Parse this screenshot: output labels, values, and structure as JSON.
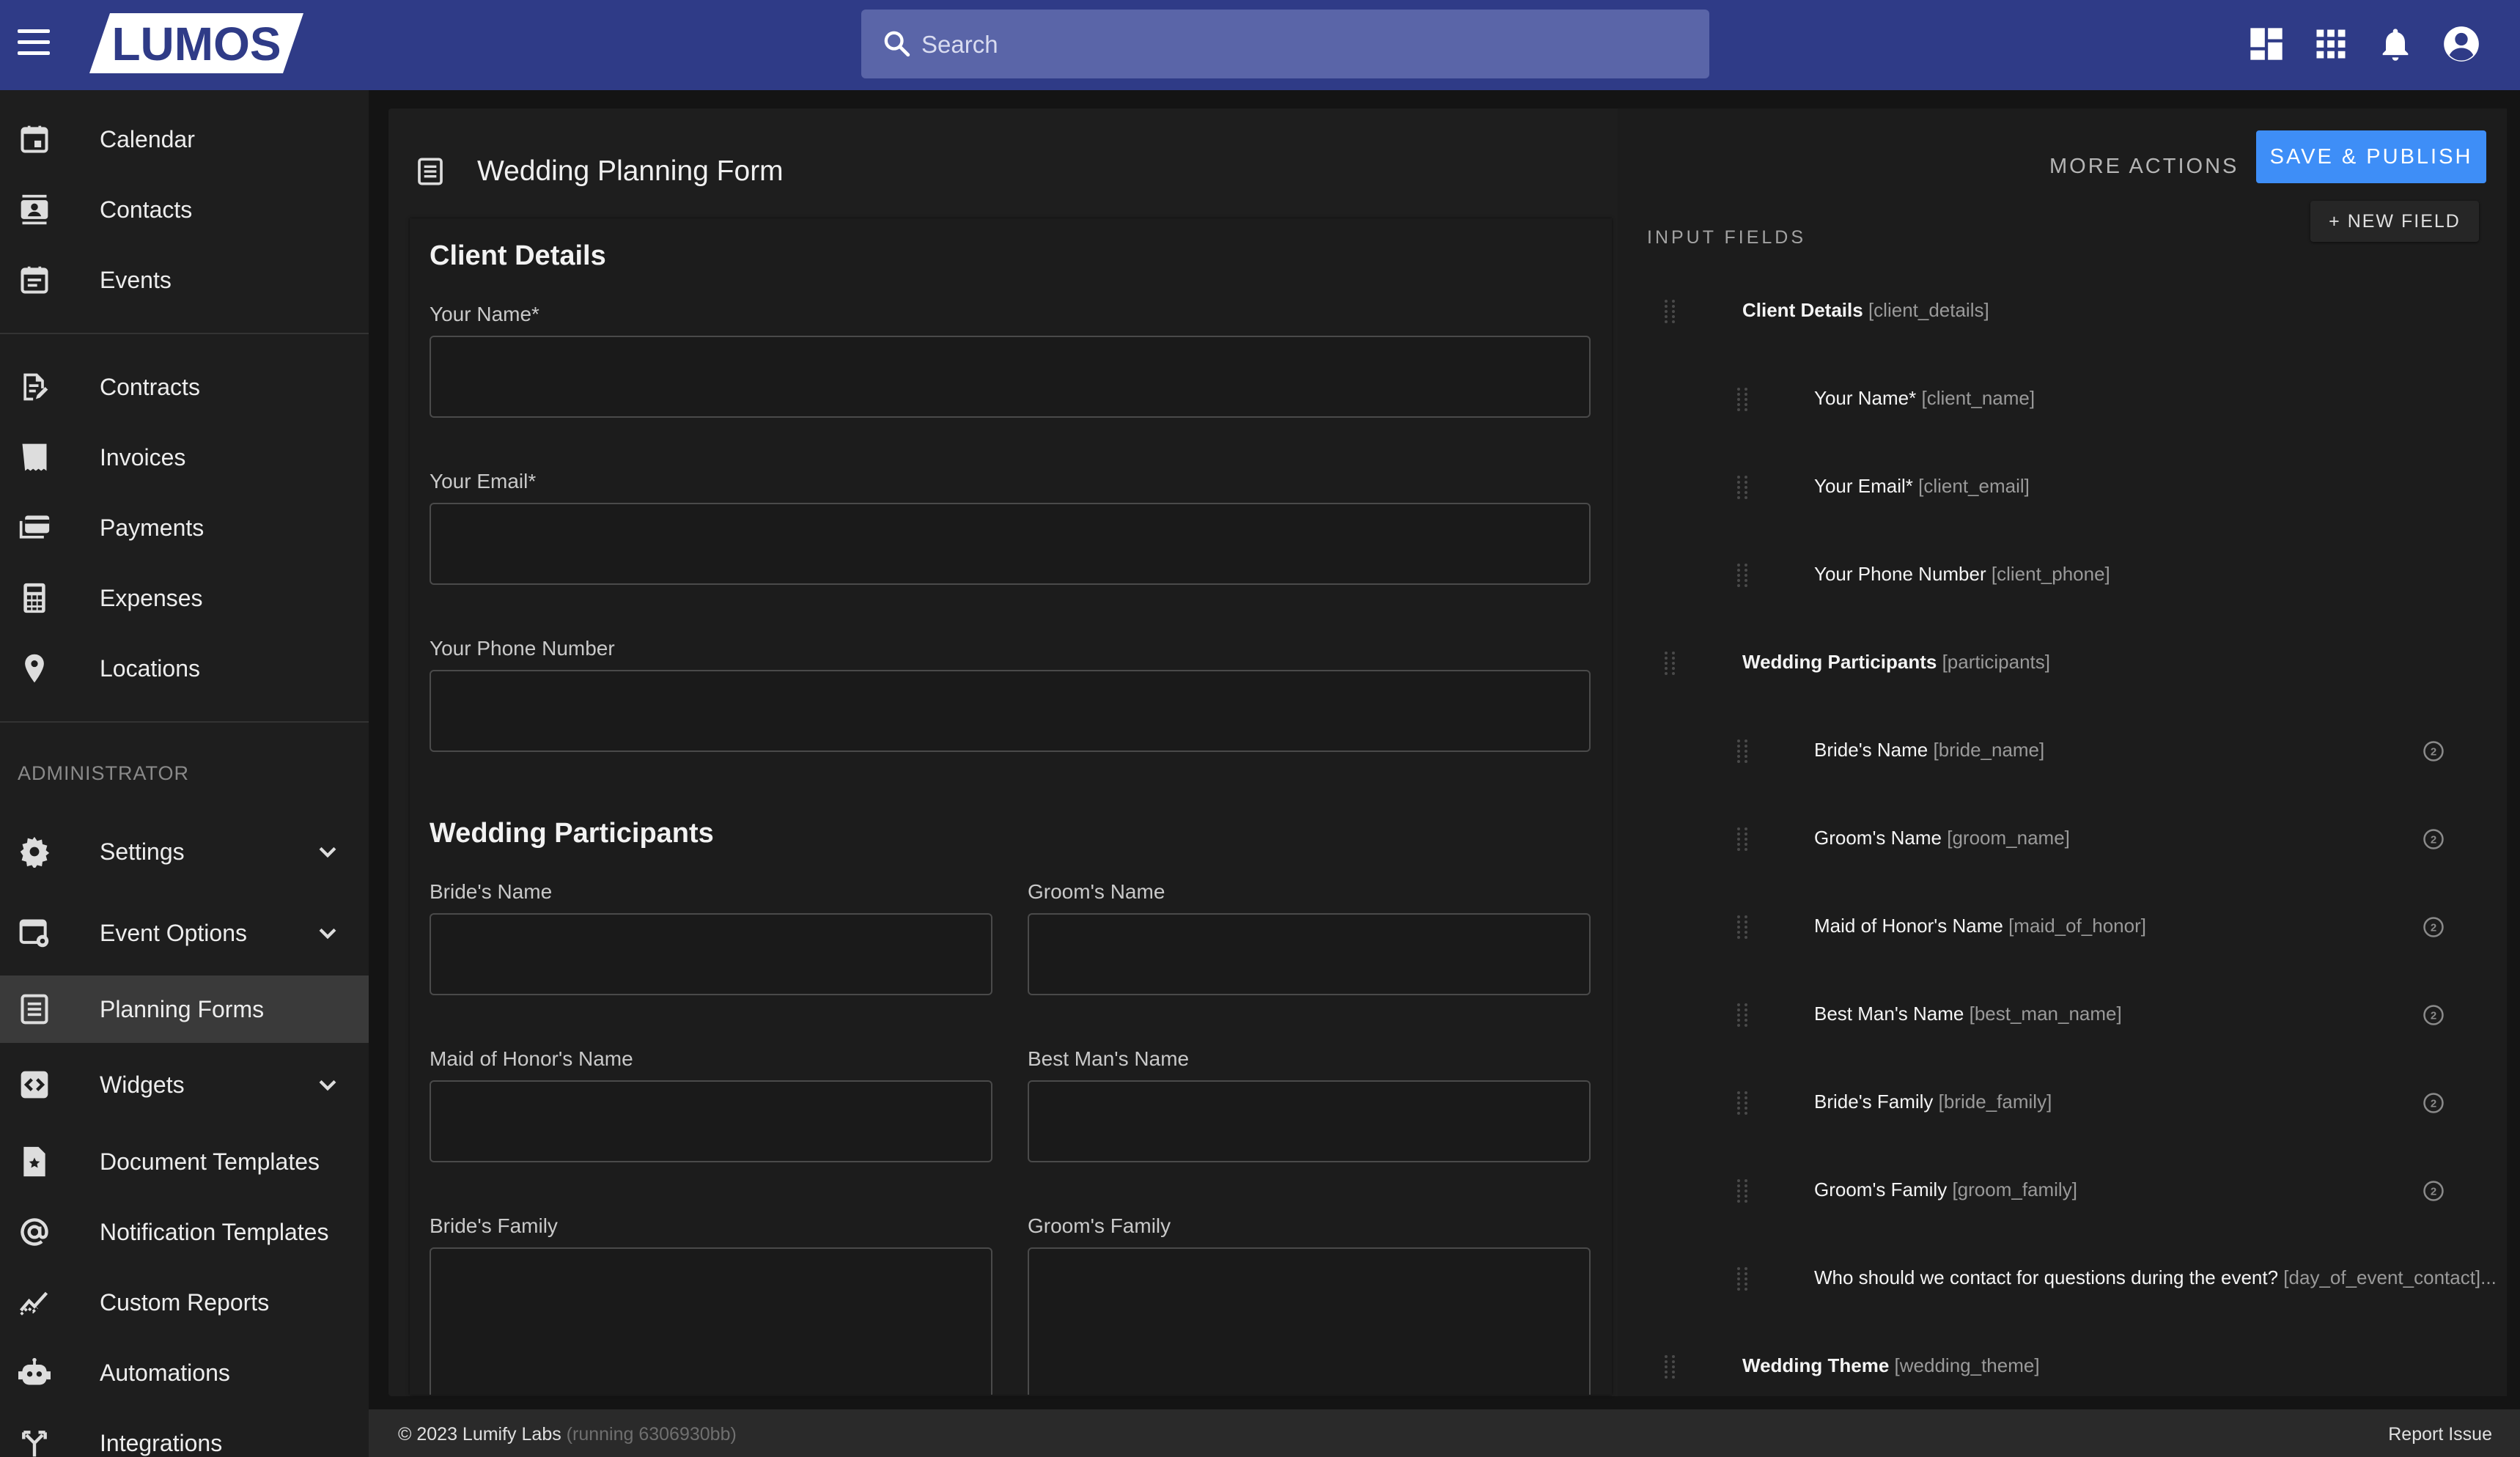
{
  "header": {
    "logo_text": "LUMOS",
    "search_placeholder": "Search"
  },
  "sidebar": {
    "items": [
      {
        "label": "Calendar",
        "icon": "calendar-icon"
      },
      {
        "label": "Contacts",
        "icon": "contacts-icon"
      },
      {
        "label": "Events",
        "icon": "events-icon"
      },
      {
        "label": "Contracts",
        "icon": "contracts-icon"
      },
      {
        "label": "Invoices",
        "icon": "invoices-icon"
      },
      {
        "label": "Payments",
        "icon": "payments-icon"
      },
      {
        "label": "Expenses",
        "icon": "calculator-icon"
      },
      {
        "label": "Locations",
        "icon": "location-pin-icon"
      },
      {
        "label": "Settings",
        "icon": "gear-icon"
      },
      {
        "label": "Event Options",
        "icon": "event-options-icon"
      },
      {
        "label": "Planning Forms",
        "icon": "planning-forms-icon"
      },
      {
        "label": "Widgets",
        "icon": "widgets-icon"
      },
      {
        "label": "Document Templates",
        "icon": "document-templates-icon"
      },
      {
        "label": "Notification Templates",
        "icon": "at-sign-icon"
      },
      {
        "label": "Custom Reports",
        "icon": "trend-chart-icon"
      },
      {
        "label": "Automations",
        "icon": "robot-icon"
      },
      {
        "label": "Integrations",
        "icon": "merge-icon"
      }
    ],
    "admin_label": "ADMINISTRATOR",
    "active": "Planning Forms"
  },
  "page": {
    "title": "Wedding Planning Form",
    "more_actions": "MORE ACTIONS",
    "save_publish": "SAVE & PUBLISH"
  },
  "form": {
    "client_details_title": "Client Details",
    "your_name": "Your Name*",
    "your_email": "Your Email*",
    "your_phone": "Your Phone Number",
    "participants_title": "Wedding Participants",
    "brides_name": "Bride's Name",
    "grooms_name": "Groom's Name",
    "maid_of_honor": "Maid of Honor's Name",
    "best_man": "Best Man's Name",
    "brides_family": "Bride's Family",
    "grooms_family": "Groom's Family"
  },
  "panel": {
    "title": "INPUT FIELDS",
    "new_field": "+ NEW FIELD",
    "fields": [
      {
        "name": "Client Details",
        "key": "[client_details]",
        "section": true
      },
      {
        "name": "Your Name*",
        "key": "[client_name]"
      },
      {
        "name": "Your Email*",
        "key": "[client_email]"
      },
      {
        "name": "Your Phone Number",
        "key": "[client_phone]"
      },
      {
        "name": "Wedding Participants",
        "key": "[participants]",
        "section": true
      },
      {
        "name": "Bride's Name",
        "key": "[bride_name]",
        "half": true
      },
      {
        "name": "Groom's Name",
        "key": "[groom_name]",
        "half": true
      },
      {
        "name": "Maid of Honor's Name",
        "key": "[maid_of_honor]",
        "half": true
      },
      {
        "name": "Best Man's Name",
        "key": "[best_man_name]",
        "half": true
      },
      {
        "name": "Bride's Family",
        "key": "[bride_family]",
        "half": true
      },
      {
        "name": "Groom's Family",
        "key": "[groom_family]",
        "half": true
      },
      {
        "name": "Who should we contact for questions during the event?",
        "key": "[day_of_event_contact]..."
      },
      {
        "name": "Wedding Theme",
        "key": "[wedding_theme]",
        "section": true
      }
    ]
  },
  "footer": {
    "copyright": "© 2023 Lumify Labs",
    "running": "(running 6306930bb)",
    "report_issue": "Report Issue"
  }
}
